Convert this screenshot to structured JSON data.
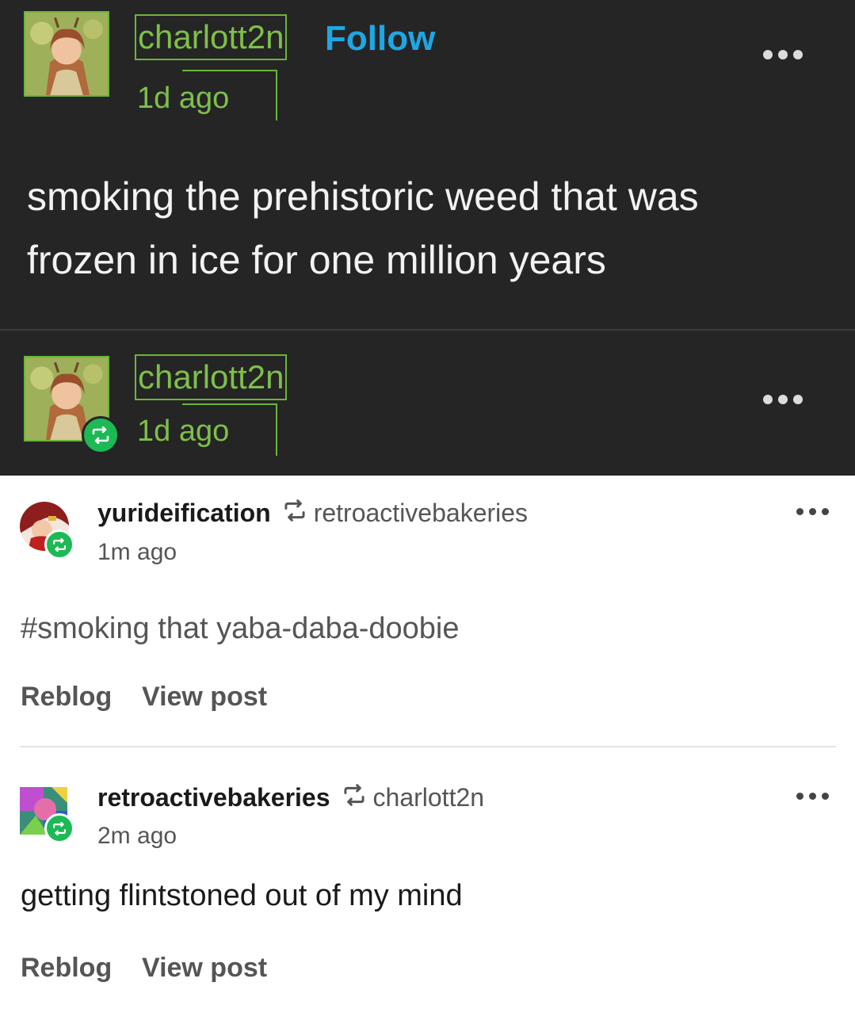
{
  "original_post": {
    "username": "charlott2n",
    "follow_label": "Follow",
    "time": "1d ago",
    "text": "smoking the prehistoric weed that was frozen in ice for one million years",
    "avatar_icon": "avatar-image",
    "more_icon": "more-options-icon"
  },
  "reblog_header": {
    "username": "charlott2n",
    "time": "1d ago",
    "badge_icon": "reblog-icon"
  },
  "notes": [
    {
      "user": "yurideification",
      "source": "retroactivebakeries",
      "time": "1m ago",
      "text": "#smoking that yaba-daba-doobie",
      "reblog_label": "Reblog",
      "view_label": "View post"
    },
    {
      "user": "retroactivebakeries",
      "source": "charlott2n",
      "time": "2m ago",
      "text": "getting flintstoned out of my mind",
      "reblog_label": "Reblog",
      "view_label": "View post"
    }
  ],
  "colors": {
    "dark_bg": "#252525",
    "highlight_green": "#6bb536",
    "follow_blue": "#1ea7e4",
    "badge_green": "#1db954"
  }
}
